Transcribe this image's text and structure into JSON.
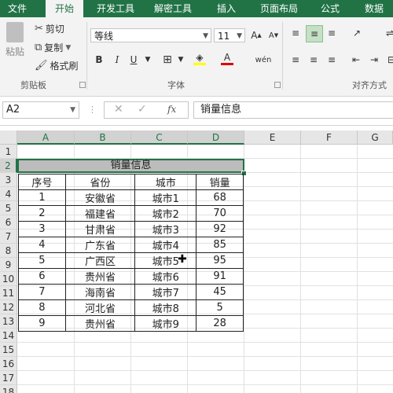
{
  "tabs": [
    "文件",
    "开始",
    "开发工具",
    "解密工具",
    "插入",
    "页面布局",
    "公式",
    "数据"
  ],
  "ribbon": {
    "clipboard": {
      "paste": "粘贴",
      "cut": "剪切",
      "copy": "复制",
      "format_painter": "格式刷",
      "group_label": "剪贴板"
    },
    "font": {
      "font_name": "等线",
      "font_size": "11",
      "group_label": "字体",
      "bold": "B",
      "italic": "I",
      "underline": "U"
    },
    "align": {
      "group_label": "对齐方式"
    }
  },
  "formula_bar": {
    "name_box": "A2",
    "formula": "销量信息"
  },
  "columns": [
    "A",
    "B",
    "C",
    "D",
    "E",
    "F",
    "G"
  ],
  "rows": [
    "1",
    "2",
    "3",
    "4",
    "5",
    "6",
    "7",
    "8",
    "9",
    "10",
    "11",
    "12",
    "13",
    "14",
    "15",
    "16",
    "17",
    "18"
  ],
  "sheet": {
    "title": "销量信息",
    "headers": [
      "序号",
      "省份",
      "城市",
      "销量"
    ],
    "data": [
      [
        "1",
        "安徽省",
        "城市1",
        "68"
      ],
      [
        "2",
        "福建省",
        "城市2",
        "70"
      ],
      [
        "3",
        "甘肃省",
        "城市3",
        "92"
      ],
      [
        "4",
        "广东省",
        "城市4",
        "85"
      ],
      [
        "5",
        "广西区",
        "城市5",
        "95"
      ],
      [
        "6",
        "贵州省",
        "城市6",
        "91"
      ],
      [
        "7",
        "海南省",
        "城市7",
        "45"
      ],
      [
        "8",
        "河北省",
        "城市8",
        "5"
      ],
      [
        "9",
        "贵州省",
        "城市9",
        "28"
      ]
    ]
  },
  "colors": {
    "accent": "#217346",
    "header_fill": "#bcbcbc"
  }
}
